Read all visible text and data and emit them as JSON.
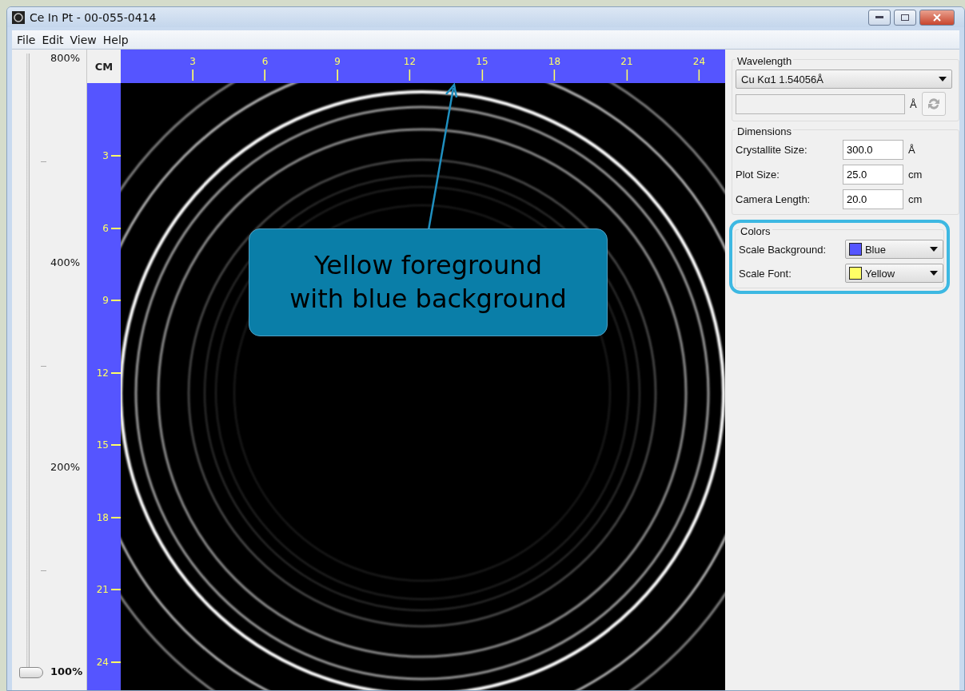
{
  "window": {
    "title": "Ce In Pt - 00-055-0414"
  },
  "menu": [
    {
      "label": "File"
    },
    {
      "label": "Edit"
    },
    {
      "label": "View"
    },
    {
      "label": "Help"
    }
  ],
  "zoom_slider": {
    "level": 0,
    "labels": [
      {
        "label": "800%",
        "selected": false
      },
      {
        "label": "400%",
        "selected": false
      },
      {
        "label": "200%",
        "selected": false
      },
      {
        "label": "100%",
        "selected": true
      }
    ]
  },
  "ruler": {
    "unit": "CM",
    "top_ticks": [
      "3",
      "6",
      "9",
      "12",
      "15",
      "18",
      "21",
      "24"
    ],
    "left_ticks": [
      "3",
      "6",
      "9",
      "12",
      "15",
      "18",
      "21",
      "24"
    ]
  },
  "wavelength": {
    "title": "Wavelength",
    "selected_option": "Cu Kα1 1.54056Å",
    "custom_unit": "Å"
  },
  "dimensions": {
    "title": "Dimensions",
    "fields": [
      {
        "label": "Crystallite Size:",
        "value": "300.0",
        "unit": "Å"
      },
      {
        "label": "Plot Size:",
        "value": "25.0",
        "unit": "cm"
      },
      {
        "label": "Camera Length:",
        "value": "20.0",
        "unit": "cm"
      }
    ]
  },
  "colors": {
    "title": "Colors",
    "fields": [
      {
        "label": "Scale Background:",
        "value": "Blue",
        "color": "#5555ff"
      },
      {
        "label": "Scale Font:",
        "value": "Yellow",
        "color": "#ffff66"
      }
    ]
  },
  "callout": {
    "text": "Yellow foreground\nwith blue background"
  }
}
